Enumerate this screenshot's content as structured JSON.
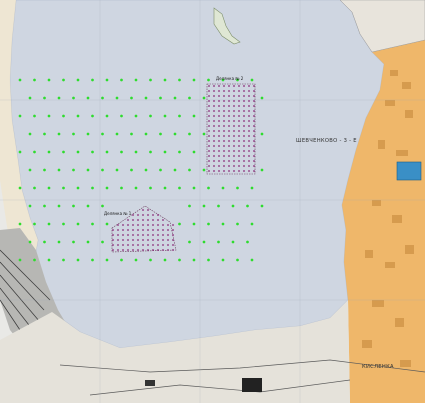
{
  "map": {
    "sites": [
      {
        "id": "site-1",
        "label": "Делянка № 1",
        "point_count": 70
      },
      {
        "id": "site-2",
        "label": "Делянка № 2",
        "point_count": 180
      }
    ],
    "places": [
      {
        "id": "shevchenko",
        "label": "ШЕВЧЕНКОВО - 3 - Е"
      },
      {
        "id": "kislenka",
        "label": "КИСЛЕНКА"
      }
    ],
    "colors": {
      "water": "#cdd4e0",
      "land": "#ececec",
      "urban": "#f0b05a",
      "green_points": "#2edc2e",
      "grid_points": "#8b2a7a"
    },
    "survey_rows": 11
  }
}
